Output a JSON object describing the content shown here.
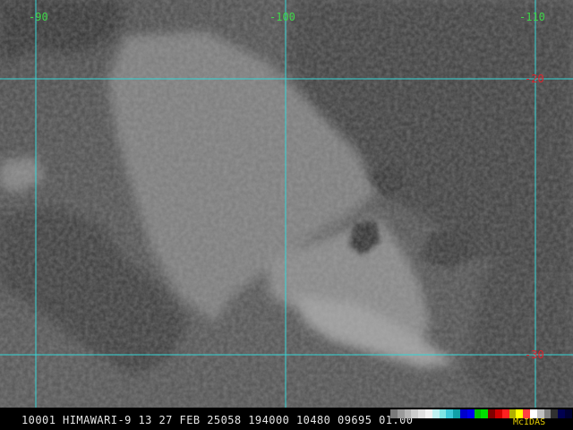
{
  "graticule": {
    "color": "#35d6d6",
    "lon_label_color": "#3fd64a",
    "lat_label_color": "#e0202a",
    "longitudes": [
      {
        "value": -90,
        "label": "-90"
      },
      {
        "value": -100,
        "label": "-100"
      },
      {
        "value": -110,
        "label": "-110"
      }
    ],
    "latitudes": [
      {
        "value": -20,
        "label": "-20"
      },
      {
        "value": -30,
        "label": "-30"
      }
    ]
  },
  "status_bar": {
    "text": "10001 HIMAWARI-9 13 27 FEB 25058 194000 10480 09695 01.00",
    "text_color": "#e6e6e6",
    "brand": "McIDAS",
    "brand_color": "#e8d000"
  },
  "colorbar": {
    "colors": [
      "#7a7a7a",
      "#9a9a9a",
      "#b4b4b4",
      "#cccccc",
      "#e0e0e0",
      "#f2f2f2",
      "#bff2f2",
      "#7fe6e6",
      "#3cc8d8",
      "#10a0a8",
      "#0000cc",
      "#0000ee",
      "#00c000",
      "#00e000",
      "#800000",
      "#d00000",
      "#ff2020",
      "#b0b000",
      "#ffff00",
      "#ff4040",
      "#ffffff",
      "#c0c0c0",
      "#808080",
      "#303030",
      "#000050",
      "#000030"
    ]
  }
}
